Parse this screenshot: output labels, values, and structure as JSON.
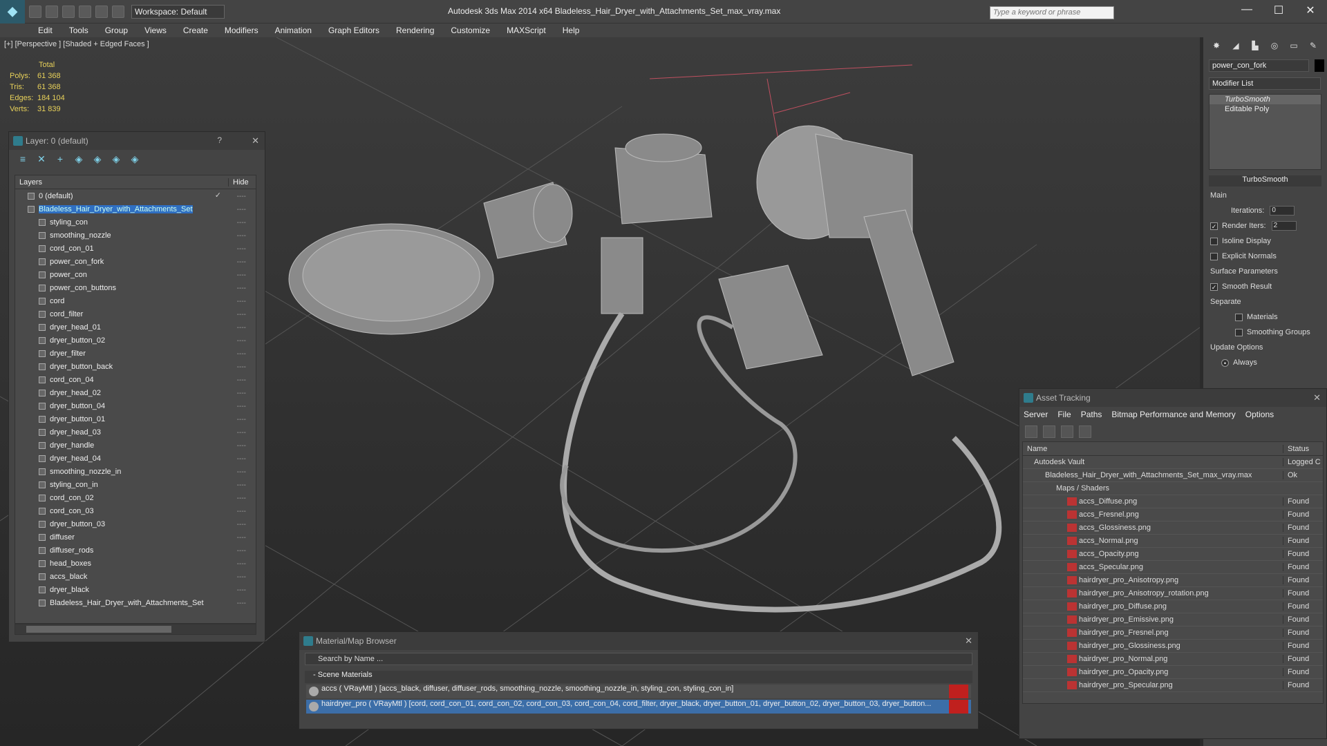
{
  "app": {
    "title": "Autodesk 3ds Max  2014 x64      Bladeless_Hair_Dryer_with_Attachments_Set_max_vray.max",
    "workspace": "Workspace: Default",
    "search_placeholder": "Type a keyword or phrase"
  },
  "menu": [
    "Edit",
    "Tools",
    "Group",
    "Views",
    "Create",
    "Modifiers",
    "Animation",
    "Graph Editors",
    "Rendering",
    "Customize",
    "MAXScript",
    "Help"
  ],
  "viewport": {
    "label": "[+] [Perspective ] [Shaded + Edged Faces ]",
    "stats": {
      "header": "Total",
      "rows": [
        {
          "label": "Polys:",
          "value": "61 368"
        },
        {
          "label": "Tris:",
          "value": "61 368"
        },
        {
          "label": "Edges:",
          "value": "184 104"
        },
        {
          "label": "Verts:",
          "value": "31 839"
        }
      ]
    }
  },
  "layer_panel": {
    "title": "Layer: 0 (default)",
    "help": "?",
    "col_layers": "Layers",
    "col_hide": "Hide",
    "rows": [
      {
        "name": "0 (default)",
        "level": 1,
        "check": true
      },
      {
        "name": "Bladeless_Hair_Dryer_with_Attachments_Set",
        "level": 1,
        "selected": true
      },
      {
        "name": "styling_con",
        "level": 2
      },
      {
        "name": "smoothing_nozzle",
        "level": 2
      },
      {
        "name": "cord_con_01",
        "level": 2
      },
      {
        "name": "power_con_fork",
        "level": 2
      },
      {
        "name": "power_con",
        "level": 2
      },
      {
        "name": "power_con_buttons",
        "level": 2
      },
      {
        "name": "cord",
        "level": 2
      },
      {
        "name": "cord_filter",
        "level": 2
      },
      {
        "name": "dryer_head_01",
        "level": 2
      },
      {
        "name": "dryer_button_02",
        "level": 2
      },
      {
        "name": "dryer_filter",
        "level": 2
      },
      {
        "name": "dryer_button_back",
        "level": 2
      },
      {
        "name": "cord_con_04",
        "level": 2
      },
      {
        "name": "dryer_head_02",
        "level": 2
      },
      {
        "name": "dryer_button_04",
        "level": 2
      },
      {
        "name": "dryer_button_01",
        "level": 2
      },
      {
        "name": "dryer_head_03",
        "level": 2
      },
      {
        "name": "dryer_handle",
        "level": 2
      },
      {
        "name": "dryer_head_04",
        "level": 2
      },
      {
        "name": "smoothing_nozzle_in",
        "level": 2
      },
      {
        "name": "styling_con_in",
        "level": 2
      },
      {
        "name": "cord_con_02",
        "level": 2
      },
      {
        "name": "cord_con_03",
        "level": 2
      },
      {
        "name": "dryer_button_03",
        "level": 2
      },
      {
        "name": "diffuser",
        "level": 2
      },
      {
        "name": "diffuser_rods",
        "level": 2
      },
      {
        "name": "head_boxes",
        "level": 2
      },
      {
        "name": "accs_black",
        "level": 2
      },
      {
        "name": "dryer_black",
        "level": 2
      },
      {
        "name": "Bladeless_Hair_Dryer_with_Attachments_Set",
        "level": 2
      }
    ]
  },
  "command_panel": {
    "object_name": "power_con_fork",
    "modifier_list": "Modifier List",
    "stack": [
      "TurboSmooth",
      "Editable Poly"
    ],
    "rollout": "TurboSmooth",
    "main": "Main",
    "iterations_label": "Iterations:",
    "iterations": "0",
    "render_iters_label": "Render Iters:",
    "render_iters": "2",
    "isoline": "Isoline Display",
    "explicit": "Explicit Normals",
    "surface": "Surface Parameters",
    "smooth_result": "Smooth Result",
    "separate": "Separate",
    "materials": "Materials",
    "smoothing_groups": "Smoothing Groups",
    "update": "Update Options",
    "always": "Always"
  },
  "asset_tracking": {
    "title": "Asset Tracking",
    "menu": [
      "Server",
      "File",
      "Paths",
      "Bitmap Performance and Memory",
      "Options"
    ],
    "col_name": "Name",
    "col_status": "Status",
    "rows": [
      {
        "name": "Autodesk Vault",
        "status": "Logged C",
        "indent": 1
      },
      {
        "name": "Bladeless_Hair_Dryer_with_Attachments_Set_max_vray.max",
        "status": "Ok",
        "indent": 2
      },
      {
        "name": "Maps / Shaders",
        "status": "",
        "indent": 3
      },
      {
        "name": "accs_Diffuse.png",
        "status": "Found",
        "indent": 4
      },
      {
        "name": "accs_Fresnel.png",
        "status": "Found",
        "indent": 4
      },
      {
        "name": "accs_Glossiness.png",
        "status": "Found",
        "indent": 4
      },
      {
        "name": "accs_Normal.png",
        "status": "Found",
        "indent": 4
      },
      {
        "name": "accs_Opacity.png",
        "status": "Found",
        "indent": 4
      },
      {
        "name": "accs_Specular.png",
        "status": "Found",
        "indent": 4
      },
      {
        "name": "hairdryer_pro_Anisotropy.png",
        "status": "Found",
        "indent": 4
      },
      {
        "name": "hairdryer_pro_Anisotropy_rotation.png",
        "status": "Found",
        "indent": 4
      },
      {
        "name": "hairdryer_pro_Diffuse.png",
        "status": "Found",
        "indent": 4
      },
      {
        "name": "hairdryer_pro_Emissive.png",
        "status": "Found",
        "indent": 4
      },
      {
        "name": "hairdryer_pro_Fresnel.png",
        "status": "Found",
        "indent": 4
      },
      {
        "name": "hairdryer_pro_Glossiness.png",
        "status": "Found",
        "indent": 4
      },
      {
        "name": "hairdryer_pro_Normal.png",
        "status": "Found",
        "indent": 4
      },
      {
        "name": "hairdryer_pro_Opacity.png",
        "status": "Found",
        "indent": 4
      },
      {
        "name": "hairdryer_pro_Specular.png",
        "status": "Found",
        "indent": 4
      }
    ]
  },
  "material_browser": {
    "title": "Material/Map Browser",
    "search": "Search by Name ...",
    "section": "- Scene Materials",
    "rows": [
      "accs  ( VRayMtl ) [accs_black, diffuser, diffuser_rods, smoothing_nozzle, smoothing_nozzle_in, styling_con, styling_con_in]",
      "hairdryer_pro  ( VRayMtl ) [cord, cord_con_01, cord_con_02, cord_con_03, cord_con_04, cord_filter, dryer_black, dryer_button_01, dryer_button_02, dryer_button_03, dryer_button..."
    ]
  }
}
